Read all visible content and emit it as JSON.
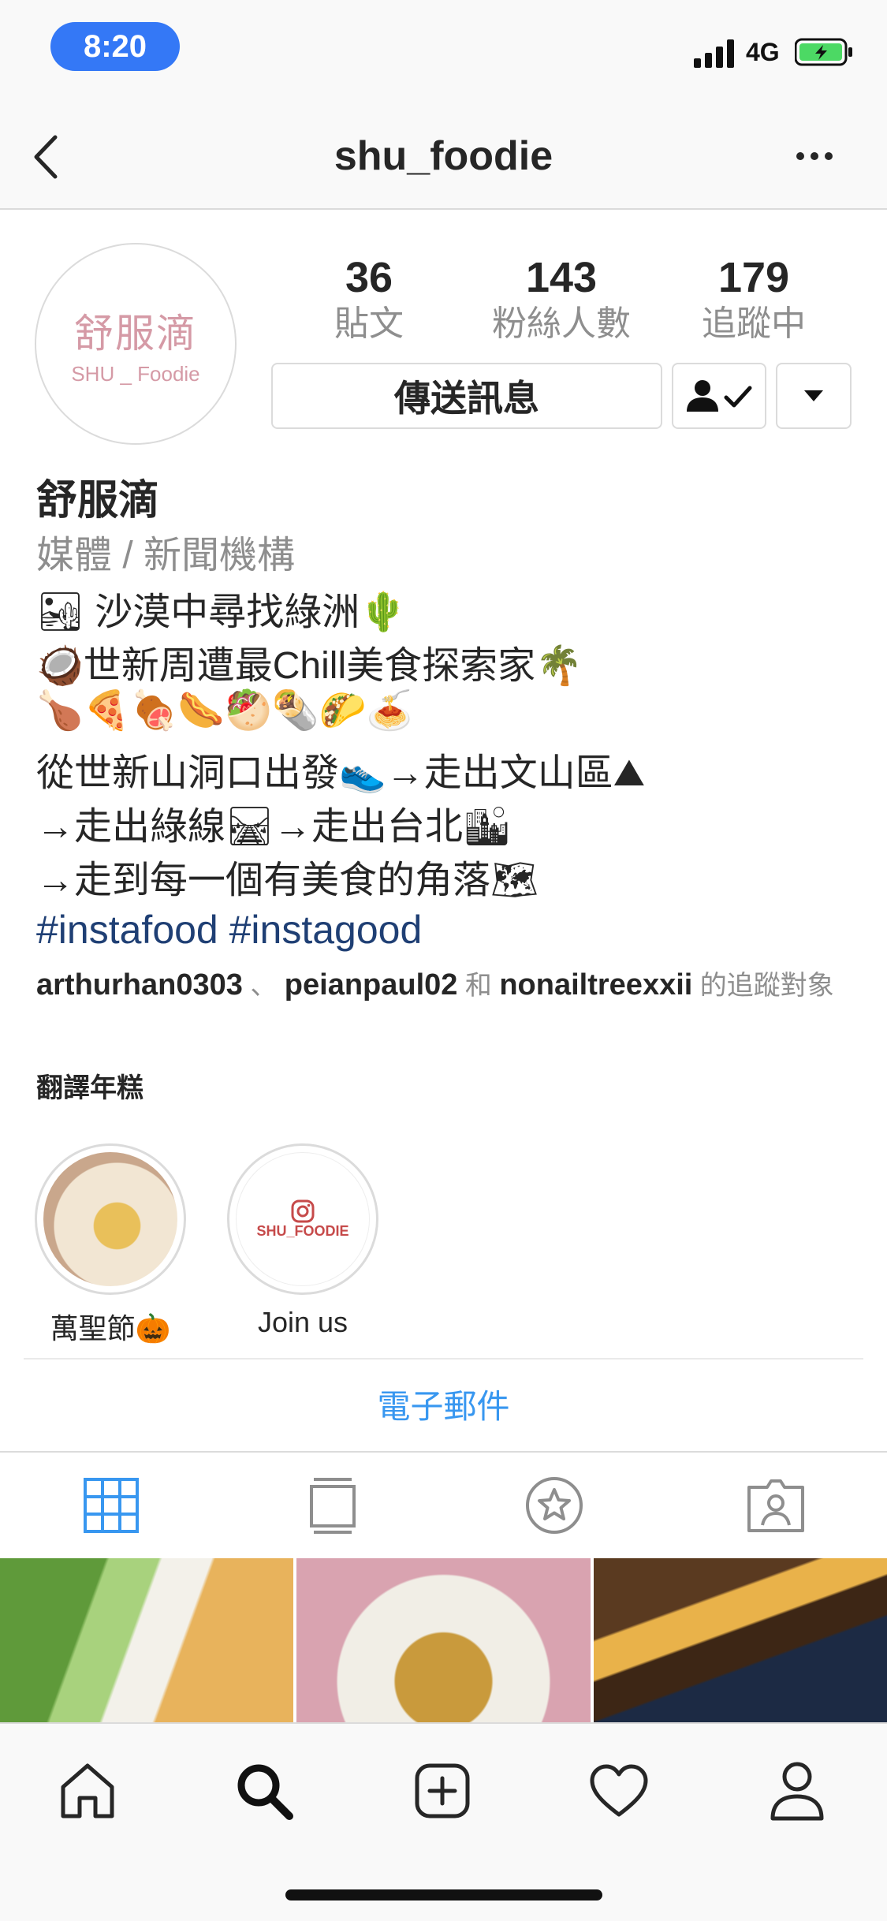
{
  "status_bar": {
    "time": "8:20",
    "network": "4G"
  },
  "header": {
    "username": "shu_foodie"
  },
  "avatar": {
    "cn_text": "舒服滴",
    "en_text": "SHU _ Foodie"
  },
  "stats": [
    {
      "value": "36",
      "label": "貼文"
    },
    {
      "value": "143",
      "label": "粉絲人數"
    },
    {
      "value": "179",
      "label": "追蹤中"
    }
  ],
  "actions": {
    "message_label": "傳送訊息"
  },
  "profile": {
    "display_name": "舒服滴",
    "category": "媒體 / 新聞機構",
    "bio_lines": [
      "🏜 沙漠中尋找綠洲🌵",
      "🥥世新周遭最Chill美食探索家🌴",
      "🍗🍕🍖🌭🥙🌯🌮🍝",
      "從世新山洞口出發👟→走出文山區⛰",
      "→走出綠線🛤→走出台北🏙",
      "→走到每一個有美食的角落🗺"
    ],
    "hashtags": "#instafood #instagood",
    "followed_by": {
      "user1": "arthurhan0303",
      "sep1": "、",
      "user2": "peianpaul02",
      "and": "和",
      "user3": "nonailtreexxii",
      "suffix": "的追蹤對象"
    },
    "translate_label": "翻譯年糕"
  },
  "highlights": [
    {
      "label": "萬聖節🎃"
    },
    {
      "label": "Join us",
      "brand": "SHU_FOODIE"
    }
  ],
  "email_label": "電子郵件",
  "tabs": [
    "grid-icon",
    "igtv-icon",
    "guides-icon",
    "tagged-icon"
  ],
  "bottom_nav": [
    "home-icon",
    "search-icon",
    "add-post-icon",
    "activity-heart-icon",
    "profile-icon"
  ],
  "colors": {
    "accent": "#3897f0",
    "hashtag": "#1f3f74",
    "time_pill": "#3478f6",
    "muted": "#8e8e8e"
  }
}
